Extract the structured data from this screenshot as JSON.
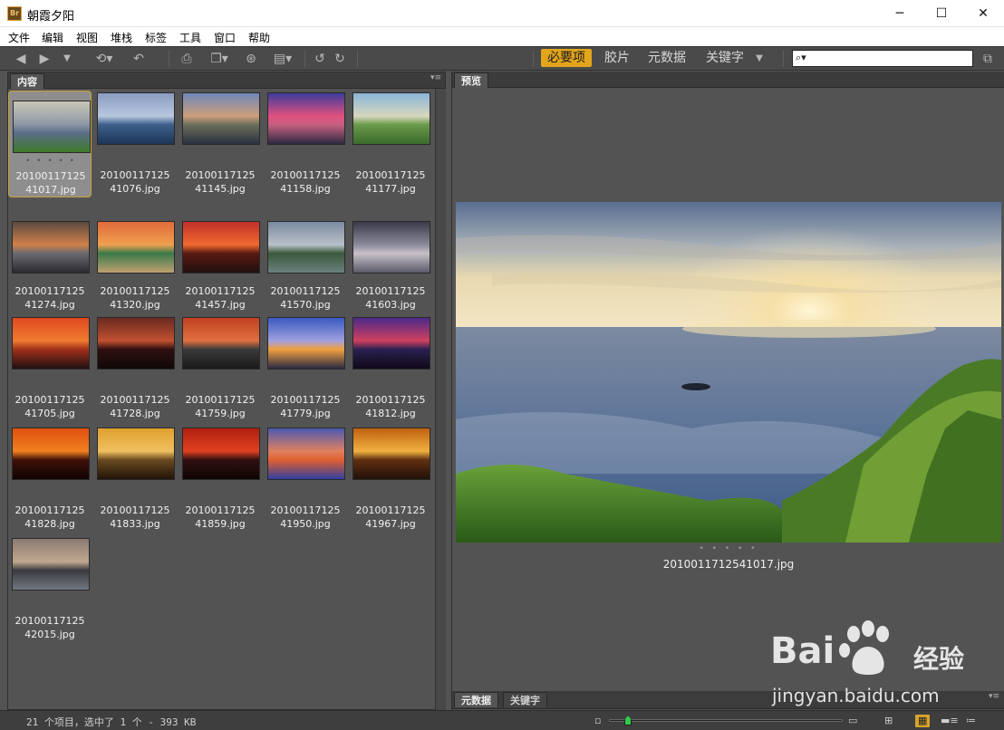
{
  "window": {
    "logo_text": "Br",
    "title": "朝霞夕阳",
    "minimize_glyph": "─",
    "maximize_glyph": "☐",
    "close_glyph": "✕"
  },
  "menu": [
    "文件",
    "编辑",
    "视图",
    "堆栈",
    "标签",
    "工具",
    "窗口",
    "帮助"
  ],
  "workspaces": {
    "essentials": "必要项",
    "filmstrip": "胶片",
    "metadata": "元数据",
    "keywords": "关键字"
  },
  "search": {
    "value": "",
    "placeholder": ""
  },
  "panels": {
    "content_tab": "内容",
    "preview_tab": "预览",
    "metadata_tab": "元数据",
    "keywords_tab": "关键字"
  },
  "thumbnails": [
    {
      "line1": "20100117125",
      "line2": "41017.jpg",
      "selected": true,
      "colors": [
        "#c9c7b8",
        "#8e98a6",
        "#5a6e88",
        "#3d7a2a"
      ]
    },
    {
      "line1": "20100117125",
      "line2": "41076.jpg",
      "selected": false,
      "colors": [
        "#8a9cc0",
        "#b8c7df",
        "#3d5f8a",
        "#1e3558"
      ]
    },
    {
      "line1": "20100117125",
      "line2": "41145.jpg",
      "selected": false,
      "colors": [
        "#6f86b8",
        "#cc9f7a",
        "#6a6e5a",
        "#2a3040"
      ]
    },
    {
      "line1": "20100117125",
      "line2": "41158.jpg",
      "selected": false,
      "colors": [
        "#3c3c9a",
        "#e05080",
        "#c66080",
        "#2c2840"
      ]
    },
    {
      "line1": "20100117125",
      "line2": "41177.jpg",
      "selected": false,
      "colors": [
        "#8ab6d8",
        "#d8d6c0",
        "#6a9a4a",
        "#3a6a2a"
      ]
    },
    {
      "line1": "20100117125",
      "line2": "41274.jpg",
      "selected": false,
      "colors": [
        "#5a4a40",
        "#d0804a",
        "#6a6a70",
        "#2a2a30"
      ]
    },
    {
      "line1": "20100117125",
      "line2": "41320.jpg",
      "selected": false,
      "colors": [
        "#e06a3a",
        "#f0a050",
        "#3a7a4a",
        "#c0a070"
      ]
    },
    {
      "line1": "20100117125",
      "line2": "41457.jpg",
      "selected": false,
      "colors": [
        "#c0302a",
        "#f06a30",
        "#5a1a10",
        "#201010"
      ]
    },
    {
      "line1": "20100117125",
      "line2": "41570.jpg",
      "selected": false,
      "colors": [
        "#7a8aa0",
        "#b8c0c8",
        "#3a5a3a",
        "#6a8080"
      ]
    },
    {
      "line1": "20100117125",
      "line2": "41603.jpg",
      "selected": false,
      "colors": [
        "#3a3a4a",
        "#8a8a9a",
        "#c8c0c8",
        "#5a5a6a"
      ]
    },
    {
      "line1": "20100117125",
      "line2": "41705.jpg",
      "selected": false,
      "colors": [
        "#e04a20",
        "#f07a30",
        "#a0301a",
        "#201010"
      ]
    },
    {
      "line1": "20100117125",
      "line2": "41728.jpg",
      "selected": false,
      "colors": [
        "#6a2a20",
        "#c05030",
        "#301010",
        "#100808"
      ]
    },
    {
      "line1": "20100117125",
      "line2": "41759.jpg",
      "selected": false,
      "colors": [
        "#c04020",
        "#e07040",
        "#3a3a3a",
        "#1a1a1a"
      ]
    },
    {
      "line1": "20100117125",
      "line2": "41779.jpg",
      "selected": false,
      "colors": [
        "#3a5ac0",
        "#a0a0e0",
        "#f0a040",
        "#2a2a40"
      ]
    },
    {
      "line1": "20100117125",
      "line2": "41812.jpg",
      "selected": false,
      "colors": [
        "#4a2a8a",
        "#d04060",
        "#2a2050",
        "#100818"
      ]
    },
    {
      "line1": "20100117125",
      "line2": "41828.jpg",
      "selected": false,
      "colors": [
        "#e05010",
        "#f08020",
        "#401008",
        "#100404"
      ]
    },
    {
      "line1": "20100117125",
      "line2": "41833.jpg",
      "selected": false,
      "colors": [
        "#e0a030",
        "#f0c060",
        "#6a4a20",
        "#201408"
      ]
    },
    {
      "line1": "20100117125",
      "line2": "41859.jpg",
      "selected": false,
      "colors": [
        "#b02010",
        "#e04020",
        "#301010",
        "#100404"
      ]
    },
    {
      "line1": "20100117125",
      "line2": "41950.jpg",
      "selected": false,
      "colors": [
        "#4a5ab0",
        "#e08060",
        "#e06030",
        "#3040a0"
      ]
    },
    {
      "line1": "20100117125",
      "line2": "41967.jpg",
      "selected": false,
      "colors": [
        "#c06010",
        "#f0b040",
        "#603010",
        "#201008"
      ]
    },
    {
      "line1": "20100117125",
      "line2": "42015.jpg",
      "selected": false,
      "colors": [
        "#8a7a70",
        "#c0a890",
        "#3a3a40",
        "#707880"
      ]
    }
  ],
  "preview": {
    "filename": "20100117125410​17.jpg",
    "caption": "2010011712541017.jpg",
    "dots": "• • • • •"
  },
  "status": {
    "text": "21 个项目，选中了 1 个 - 393 KB",
    "zoom_level": 0.05
  },
  "watermark": {
    "latin": "Bai",
    "brand_cn": "经验",
    "url": "jingyan.baidu.com"
  },
  "colors": {
    "accent": "#e2a51c",
    "panel_bg": "#535353",
    "toolbar_bg": "#4a4a4a",
    "slider_knob": "#2ecc4a"
  }
}
